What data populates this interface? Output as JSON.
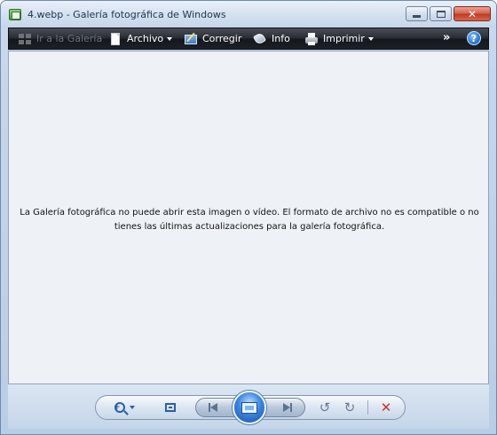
{
  "window": {
    "title": "4.webp - Galería fotográfica de Windows",
    "icons": {
      "app": "photo-gallery-icon",
      "minimize": "minimize-icon",
      "maximize": "maximize-icon",
      "close": "close-icon"
    }
  },
  "toolbar": {
    "goto_gallery": "Ir a la Galería",
    "file": "Archivo",
    "fix": "Corregir",
    "info": "Info",
    "print": "Imprimir",
    "more": "»",
    "help": "?"
  },
  "main": {
    "message": "La Galería fotográfica no puede abrir esta imagen o vídeo. El formato de archivo no es compatible o no tienes las últimas actualizaciones para la galería fotográfica."
  },
  "controls": {
    "icons": [
      "zoom-icon",
      "fit-window-icon",
      "previous-icon",
      "slideshow-icon",
      "next-icon",
      "rotate-left-icon",
      "rotate-right-icon",
      "delete-icon"
    ],
    "accent": "#2a5ea8",
    "delete_color": "#c8342a"
  }
}
